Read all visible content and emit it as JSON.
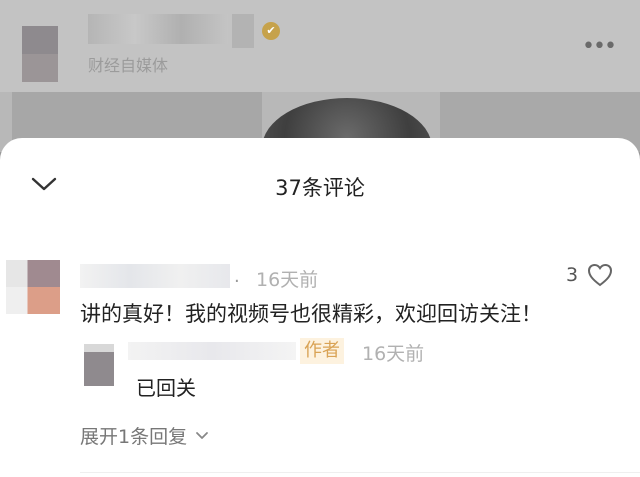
{
  "background": {
    "account_subtitle": "财经自媒体",
    "verified_icon": "verified-badge-icon",
    "more_icon": "more-dots-icon",
    "more_glyph": "•••"
  },
  "sheet": {
    "title": "37条评论",
    "collapse_icon": "chevron-down-icon"
  },
  "comment": {
    "time": "16天前",
    "like_count": "3",
    "like_icon": "heart-icon",
    "text": "讲的真好！我的视频号也很精彩，欢迎回访关注！",
    "separator": "."
  },
  "reply": {
    "author_badge": "作者",
    "time": "16天前",
    "text": "已回关"
  },
  "expand": {
    "label": "展开1条回复",
    "icon": "chevron-down-small-icon"
  }
}
